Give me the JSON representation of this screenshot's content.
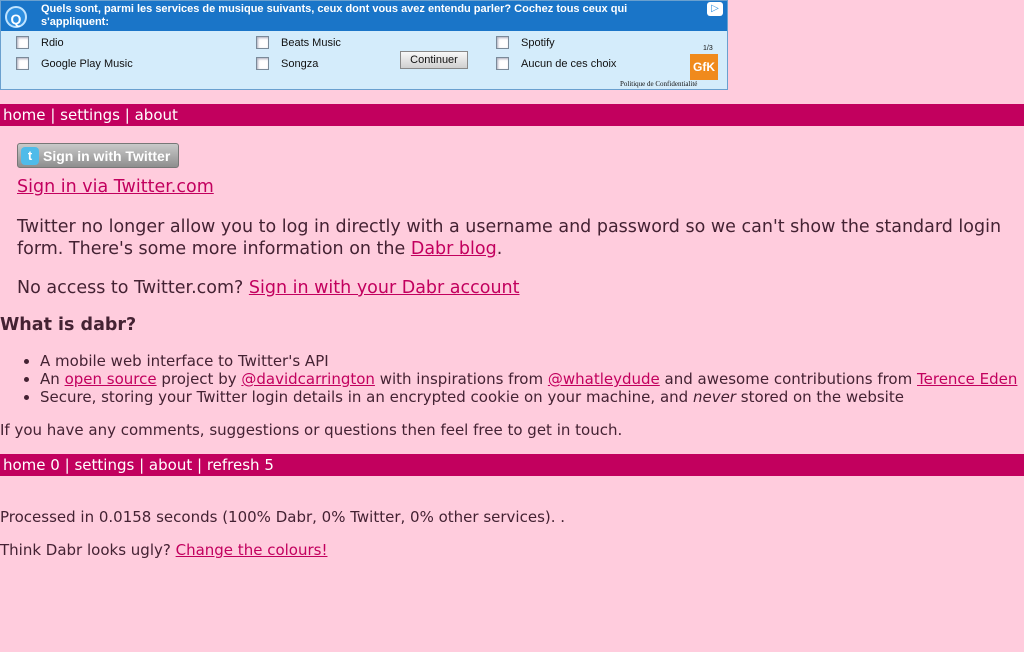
{
  "ad": {
    "question": "Quels sont, parmi les services de musique suivants, ceux dont vous avez entendu parler? Cochez tous ceux qui s'appliquent:",
    "options": [
      "Rdio",
      "Beats Music",
      "Spotify",
      "Google Play Music",
      "Songza",
      "Aucun de ces choix"
    ],
    "continue_label": "Continuer",
    "page": "1/3",
    "brand": "GfK",
    "privacy": "Politique de Confidentialité",
    "adchoices": "▷"
  },
  "top_nav": {
    "home": "home",
    "settings": "settings",
    "about": "about",
    "sep": "|"
  },
  "signin": {
    "twitter_button": "Sign in with Twitter",
    "twitter_bird": "t",
    "via_link": "Sign in via Twitter.com",
    "para_text": "Twitter no longer allow you to log in directly with a username and password so we can't show the standard login form. There's some more information on the",
    "blog_link": "Dabr blog",
    "no_access_text": "No access to Twitter.com?",
    "dabr_account_link": "Sign in with your Dabr account"
  },
  "about": {
    "heading": "What is dabr?",
    "item1": "A mobile web interface to Twitter's API",
    "item2_pre": "An",
    "item2_link1": "open source",
    "item2_mid1": "project by",
    "item2_link2": "@davidcarrington",
    "item2_mid2": "with inspirations from",
    "item2_link3": "@whatleydude",
    "item2_mid3": "and awesome contributions from",
    "item2_link4": "Terence Eden",
    "item3_pre": "Secure, storing your Twitter login details in an encrypted cookie on your machine, and",
    "item3_em": "never",
    "item3_post": "stored on the website",
    "contact": "If you have any comments, suggestions or questions then feel free to get in touch."
  },
  "bottom_nav": {
    "home": "home 0",
    "settings": "settings",
    "about": "about",
    "refresh": "refresh 5",
    "sep": "|"
  },
  "footer": {
    "processed": "Processed in 0.0158 seconds (100% Dabr, 0% Twitter, 0% other services). .",
    "ugly_text": "Think Dabr looks ugly?",
    "colours_link": "Change the colours!"
  },
  "colors": {
    "background": "#ffccdd",
    "accent": "#c2005e",
    "text": "#442233"
  }
}
